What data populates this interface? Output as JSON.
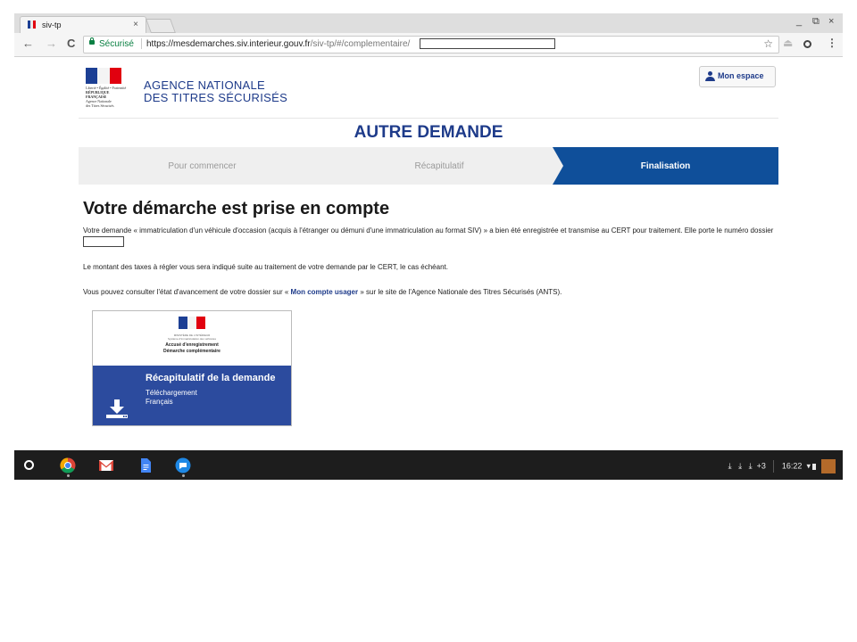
{
  "browser": {
    "tab_title": "siv-tp",
    "tab_close": "×",
    "secure_label": "Sécurisé",
    "url_host": "https://mesdemarches.siv.interieur.gouv.fr",
    "url_path": "/siv-tp/#/complementaire/",
    "minimize": "_",
    "restore": "⧉",
    "close": "×"
  },
  "header": {
    "agency_line1": "AGENCE NATIONALE",
    "agency_line2": "DES TITRES SÉCURISÉS",
    "logo_text": [
      "Liberté • Égalité • Fraternité",
      "RÉPUBLIQUE FRANÇAISE",
      "Agence Nationale",
      "des Titres Sécurisés"
    ],
    "mon_espace": "Mon espace"
  },
  "page_title": "AUTRE DEMANDE",
  "steps": [
    {
      "label": "Pour commencer",
      "active": false
    },
    {
      "label": "Récapitulatif",
      "active": false
    },
    {
      "label": "Finalisation",
      "active": true
    }
  ],
  "main": {
    "heading": "Votre démarche est prise en compte",
    "p1": "Votre demande « immatriculation d'un véhicule d'occasion (acquis à l'étranger ou démuni d'une immatriculation au format SIV) » a bien été enregistrée et transmise au CERT pour traitement. Elle porte le numéro dossier",
    "p2": "Le montant des taxes à régler vous sera indiqué suite au traitement de votre demande par le CERT, le cas échéant.",
    "p3_before": "Vous pouvez consulter l'état d'avancement de votre dossier sur « ",
    "p3_link": "Mon compte usager",
    "p3_after": " » sur le site de l'Agence Nationale des Titres Sécurisés (ANTS)."
  },
  "card": {
    "tiny1": "MINISTÈRE DE L'INTÉRIEUR",
    "tiny2": "Système d'immatriculation des véhicules",
    "ack1": "Accusé d'enregistrement",
    "ack2": "Démarche complémentaire",
    "title": "Récapitulatif de la demande",
    "sub1": "Téléchargement",
    "sub2": "Français"
  },
  "shelf": {
    "status": "+3",
    "time": "16:22"
  },
  "colors": {
    "brand_blue": "#1e3b8a",
    "step_active": "#0f4f9a",
    "card_blue": "#2c4b9e",
    "flag_blue": "#1c3f94",
    "flag_red": "#e1000f"
  }
}
